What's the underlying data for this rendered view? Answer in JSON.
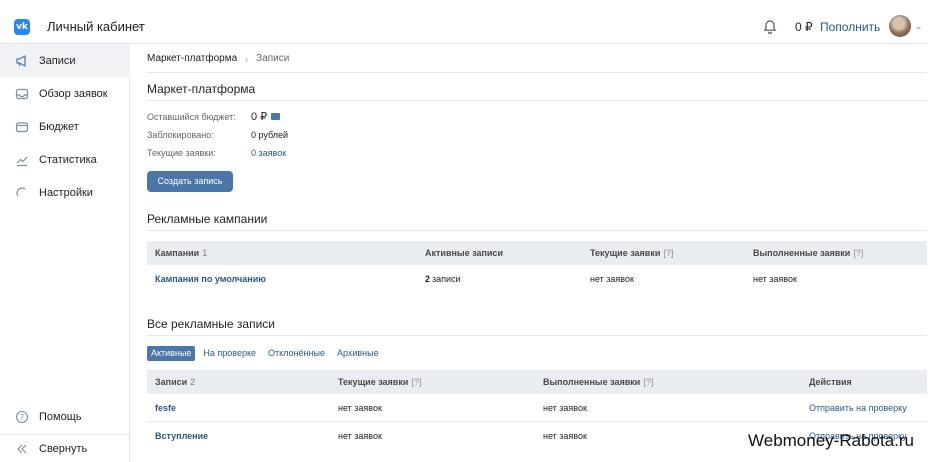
{
  "header": {
    "logo": "vk-logo",
    "logo_text": "vk",
    "title": "Личный кабинет",
    "balance": "0 ₽",
    "topup_label": "Пополнить",
    "accent": "#4a76a8"
  },
  "sidebar": {
    "items": [
      {
        "label": "Записи",
        "icon": "megaphone-icon",
        "active": true
      },
      {
        "label": "Обзор заявок",
        "icon": "inbox-icon"
      },
      {
        "label": "Бюджет",
        "icon": "wallet-icon"
      },
      {
        "label": "Статистика",
        "icon": "chart-icon"
      },
      {
        "label": "Настройки",
        "icon": "settings-icon"
      }
    ],
    "bottom": [
      {
        "label": "Помощь",
        "icon": "help-icon"
      },
      {
        "label": "Свернуть",
        "icon": "collapse-icon"
      }
    ]
  },
  "breadcrumb": {
    "parent": "Маркет-платформа",
    "current": "Записи"
  },
  "platform": {
    "title": "Маркет-платформа",
    "budget_label": "Оставшийся бюджет:",
    "budget_value": "0 ₽",
    "blocked_label": "Заблокировано:",
    "blocked_value": "0 рублей",
    "requests_label": "Текущие заявки:",
    "requests_value": "0 заявок",
    "create_button": "Создать запись"
  },
  "campaigns": {
    "title": "Рекламные кампании",
    "headers": {
      "name": "Кампании",
      "count": "1",
      "active": "Активные записи",
      "current": "Текущие заявки",
      "current_hint": "[?]",
      "done": "Выполненные заявки",
      "done_hint": "[?]"
    },
    "rows": [
      {
        "name": "Кампания по умолчанию",
        "active_num": "2",
        "active_text": "записи",
        "current": "нет заявок",
        "done": "нет заявок"
      }
    ]
  },
  "records": {
    "title": "Все рекламные записи",
    "tabs": [
      "Активные",
      "На проверке",
      "Отклонённые",
      "Архивные"
    ],
    "headers": {
      "name": "Записи",
      "count": "2",
      "current": "Текущие заявки",
      "current_hint": "[?]",
      "done": "Выполненные заявки",
      "done_hint": "[?]",
      "actions": "Действия"
    },
    "rows": [
      {
        "name": "fesfe",
        "current": "нет заявок",
        "done": "нет заявок",
        "action": "Отправить на проверку"
      },
      {
        "name": "Вступление",
        "current": "нет заявок",
        "done": "нет заявок",
        "action": "Отправить на проверку"
      }
    ]
  },
  "watermark": "Webmoney-Rabota.ru"
}
